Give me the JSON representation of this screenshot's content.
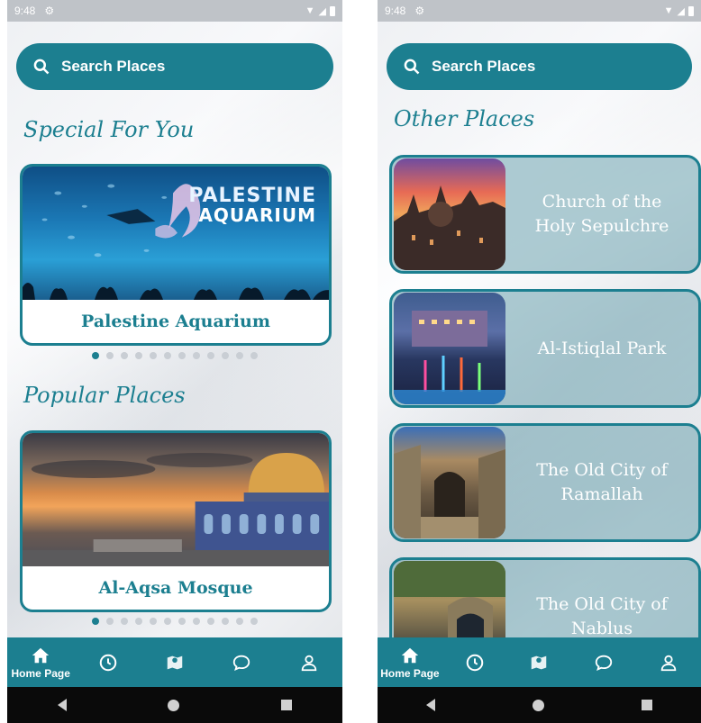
{
  "left": {
    "status": {
      "time": "9:48"
    },
    "search": {
      "placeholder": "Search Places"
    },
    "sections": {
      "special": {
        "title": "Special For You",
        "card_label": "Palestine Aquarium",
        "logo_line1": "PALESTINE",
        "logo_line2": "AQUARIUM"
      },
      "popular": {
        "title": "Popular Places",
        "card_label": "Al-Aqsa Mosque"
      }
    },
    "carousel": {
      "total": 12,
      "active": 1
    }
  },
  "right": {
    "status": {
      "time": "9:48"
    },
    "search": {
      "placeholder": "Search Places"
    },
    "section_title": "Other Places",
    "places": [
      {
        "name_line1": "Church of the",
        "name_line2": "Holy Sepulchre"
      },
      {
        "name_line1": "Al-Istiqlal Park",
        "name_line2": ""
      },
      {
        "name_line1": "The Old City of",
        "name_line2": "Ramallah"
      },
      {
        "name_line1": "The Old City of",
        "name_line2": "Nablus"
      }
    ]
  },
  "nav": {
    "home_label": "Home Page",
    "items": [
      "home-icon",
      "clock-icon",
      "map-icon",
      "chat-icon",
      "user-icon"
    ]
  },
  "colors": {
    "accent": "#1c7f90",
    "status_bar": "#bfc3c8",
    "card_overlay": "#78aab6"
  }
}
